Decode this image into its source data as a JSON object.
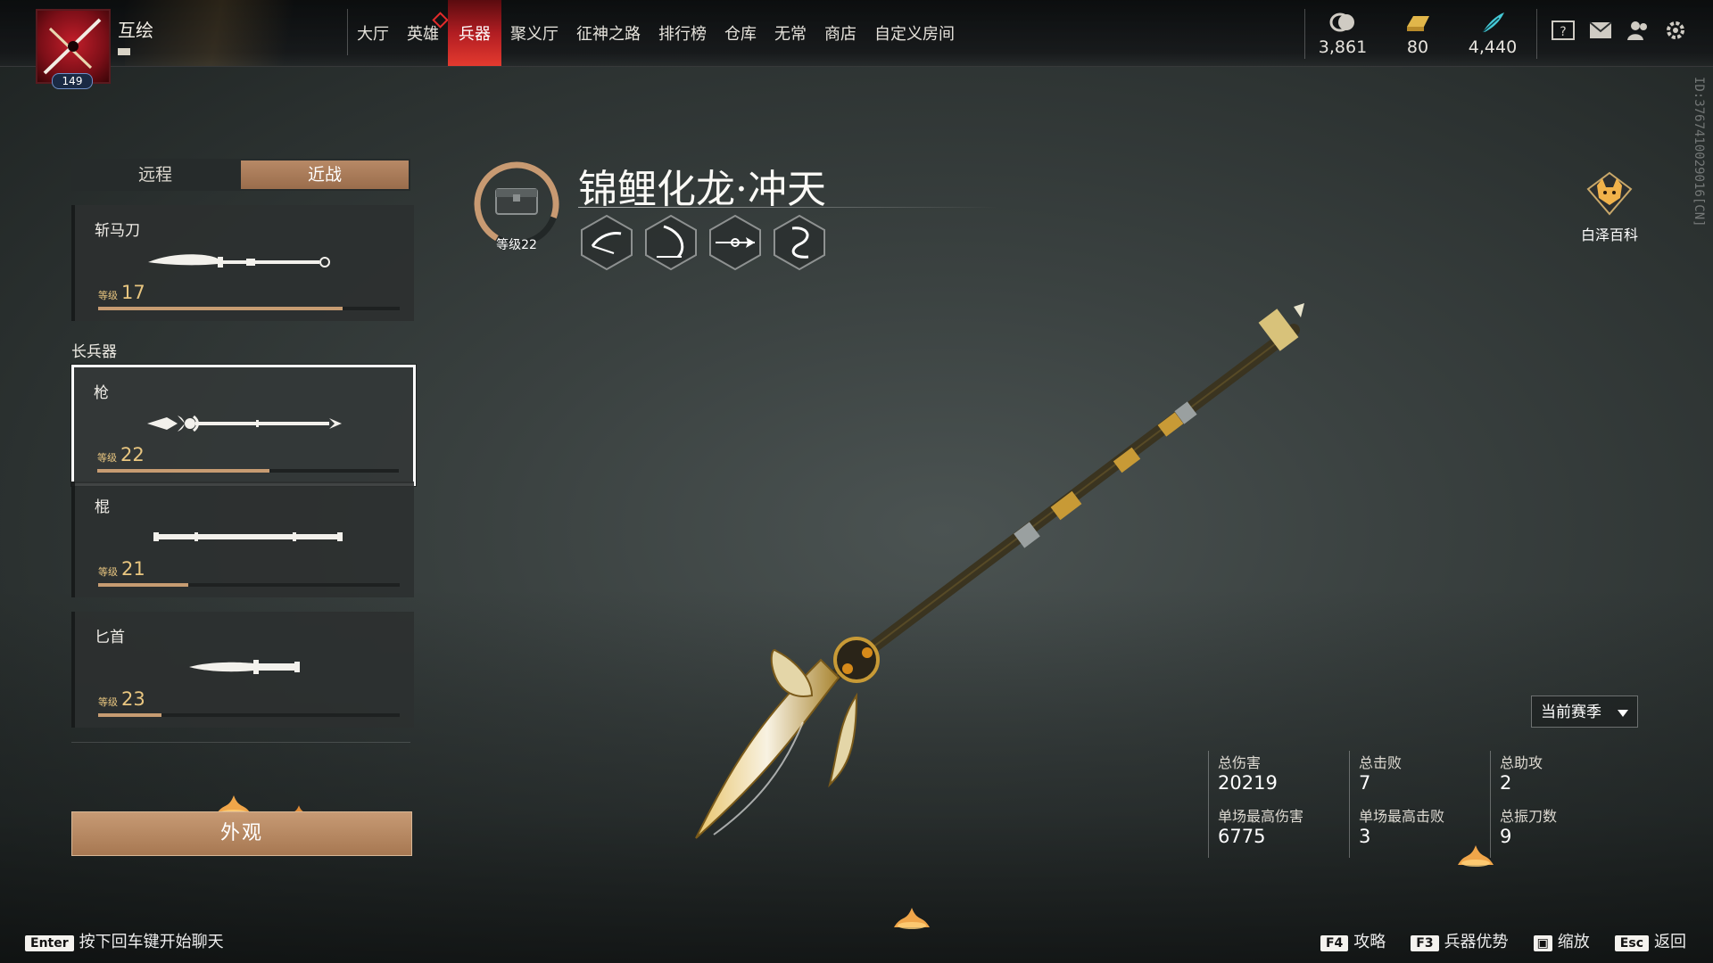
{
  "player": {
    "name": "互绘",
    "level": "149"
  },
  "nav": {
    "items": [
      "大厅",
      "英雄",
      "兵器",
      "聚义厅",
      "征神之路",
      "排行榜",
      "仓库",
      "无常",
      "商店",
      "自定义房间"
    ],
    "active_index": 2
  },
  "currencies": [
    {
      "icon": "coin-icon",
      "value": "3,861"
    },
    {
      "icon": "gold-bar-icon",
      "value": "80"
    },
    {
      "icon": "feather-icon",
      "value": "4,440"
    }
  ],
  "tabs": {
    "ranged": "远程",
    "melee": "近战",
    "active": "melee"
  },
  "weapons": {
    "zhanmadao": {
      "name": "斩马刀",
      "level_label": "等级",
      "level": "17",
      "progress": 0.81
    },
    "category": "长兵器",
    "qiang": {
      "name": "枪",
      "level_label": "等级",
      "level": "22",
      "progress": 0.57
    },
    "gun": {
      "name": "棍",
      "level_label": "等级",
      "level": "21",
      "progress": 0.3
    },
    "bishou": {
      "name": "匕首",
      "level_label": "等级",
      "level": "23",
      "progress": 0.21
    }
  },
  "appearance_button": "外观",
  "selected": {
    "title": "锦鲤化龙·冲天",
    "level_text": "等级22",
    "ring_progress": 0.72
  },
  "baize": {
    "label": "白泽百科"
  },
  "vertical_id": "ID:3767410029016[CN]",
  "season_select": "当前赛季",
  "stats": {
    "total_damage_label": "总伤害",
    "total_damage": "20219",
    "max_damage_label": "单场最高伤害",
    "max_damage": "6775",
    "total_kills_label": "总击败",
    "total_kills": "7",
    "max_kills_label": "单场最高击败",
    "max_kills": "3",
    "total_assists_label": "总助攻",
    "total_assists": "2",
    "total_parry_label": "总振刀数",
    "total_parry": "9"
  },
  "chat_hint": {
    "key": "Enter",
    "text": "按下回车键开始聊天"
  },
  "hotkeys": [
    {
      "key": "F4",
      "label": "攻略"
    },
    {
      "key": "F3",
      "label": "兵器优势"
    },
    {
      "key": "",
      "label": "缩放"
    },
    {
      "key": "Esc",
      "label": "返回"
    }
  ],
  "colors": {
    "accent_red": "#e43a2f",
    "tan": "#b78966",
    "level_gold": "#e9c680"
  }
}
